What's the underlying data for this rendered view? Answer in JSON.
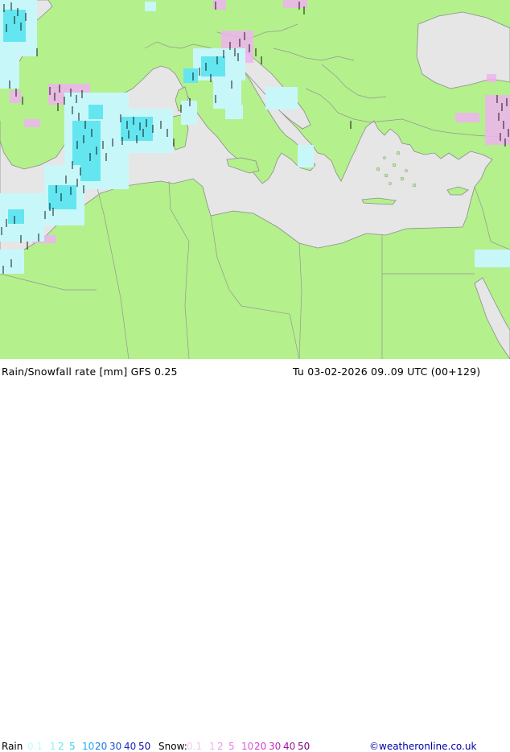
{
  "title": "Rain/Snowfall rate [mm] GFS 0.25",
  "run_info": "Tu 03-02-2026 09..09 UTC (00+129)",
  "legend": {
    "rain_label": "Rain",
    "rain_values": [
      "0.1",
      "1",
      "2",
      "5",
      "10",
      "20",
      "30",
      "40",
      "50"
    ],
    "rain_colors": [
      "#c8f7fa",
      "#96f0f6",
      "#64e6f0",
      "#32d2eb",
      "#1eaaf0",
      "#1e78e6",
      "#1e4bd2",
      "#1e28be",
      "#0a0aa0"
    ],
    "snow_label": "Snow:",
    "snow_values": [
      "0.1",
      "1",
      "2",
      "5",
      "10",
      "20",
      "30",
      "40",
      "50"
    ],
    "snow_colors": [
      "#f0c8f0",
      "#f0b4f0",
      "#eb96eb",
      "#e678e6",
      "#dc5adc",
      "#d23cd2",
      "#be28be",
      "#a014a0",
      "#780078"
    ]
  },
  "credit": "©weatheronline.co.uk",
  "colors": {
    "sea": "#e6e6e6",
    "land": "#b4f08c",
    "border": "#969696",
    "coast": "#8c8c8c",
    "rain_light": "#c8f7fa",
    "rain_mid": "#96f0f6",
    "rain_strong": "#64e6f0",
    "snow": "#f0b4f0"
  }
}
